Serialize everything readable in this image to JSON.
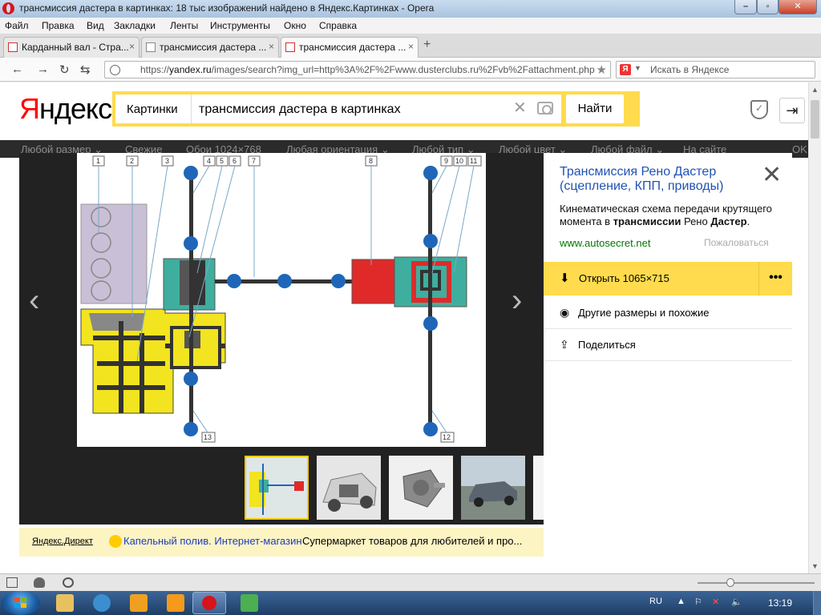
{
  "window": {
    "title": "трансмиссия дастера в картинках: 18 тыс изображений найдено в Яндекс.Картинках - Opera"
  },
  "menu": [
    "Файл",
    "Правка",
    "Вид",
    "Закладки",
    "Ленты",
    "Инструменты",
    "Окно",
    "Справка"
  ],
  "tabs": [
    {
      "label": "Карданный вал - Стра...",
      "close": "×"
    },
    {
      "label": "трансмиссия дастера ...",
      "close": "×"
    },
    {
      "label": "трансмиссия дастера ...",
      "close": "×"
    }
  ],
  "address": {
    "url_prefix": "https://",
    "url_domain": "yandex.ru",
    "url_rest": "/images/search?img_url=http%3A%2F%2Fwww.dusterclubs.ru%2Fvb%2Fattachment.php",
    "search_placeholder": "Искать в Яндексе",
    "search_engine_letter": "Я"
  },
  "yandex": {
    "logo_first": "Я",
    "logo_rest": "ндекс",
    "service": "Картинки",
    "query": "трансмиссия дастера в картинках",
    "search_button": "Найти"
  },
  "filters": [
    "Любой размер ⌄",
    "Свежие",
    "Обои 1024×768",
    "Любая ориентация ⌄",
    "Любой тип ⌄",
    "Любой цвет ⌄",
    "Любой файл ⌄",
    "На сайте",
    "OK"
  ],
  "viewer": {
    "prev": "‹",
    "next": "›",
    "diagram_labels": [
      "1",
      "2",
      "3",
      "4",
      "5",
      "6",
      "7",
      "8",
      "9",
      "10",
      "11",
      "12",
      "13"
    ]
  },
  "panel": {
    "title": "Трансмиссия Рено Дастер (сцепление, КПП, приводы)",
    "desc_1": "Кинематическая схема передачи крутящего момента в ",
    "desc_bold_1": "трансмиссии",
    "desc_2": " Рено ",
    "desc_bold_2": "Дастер",
    "desc_3": ".",
    "source": "www.autosecret.net",
    "report": "Пожаловаться",
    "open_label": "Открыть 1065×715",
    "more": "•••",
    "similar": "Другие размеры и похожие",
    "share": "Поделиться"
  },
  "direct": {
    "label": "Яндекс.Директ",
    "link": "Капельный полив. Интернет-магазин",
    "text": "Супермаркет товаров для любителей и про..."
  },
  "taskbar": {
    "lang": "RU",
    "time": "13:19"
  },
  "colors": {
    "yandex_yellow": "#ffdb4d",
    "diagram_yellow": "#f2e41e",
    "diagram_teal": "#3fae9e",
    "diagram_red": "#e02a2a",
    "diagram_blue": "#1f66b9",
    "link_blue": "#2052b5"
  }
}
